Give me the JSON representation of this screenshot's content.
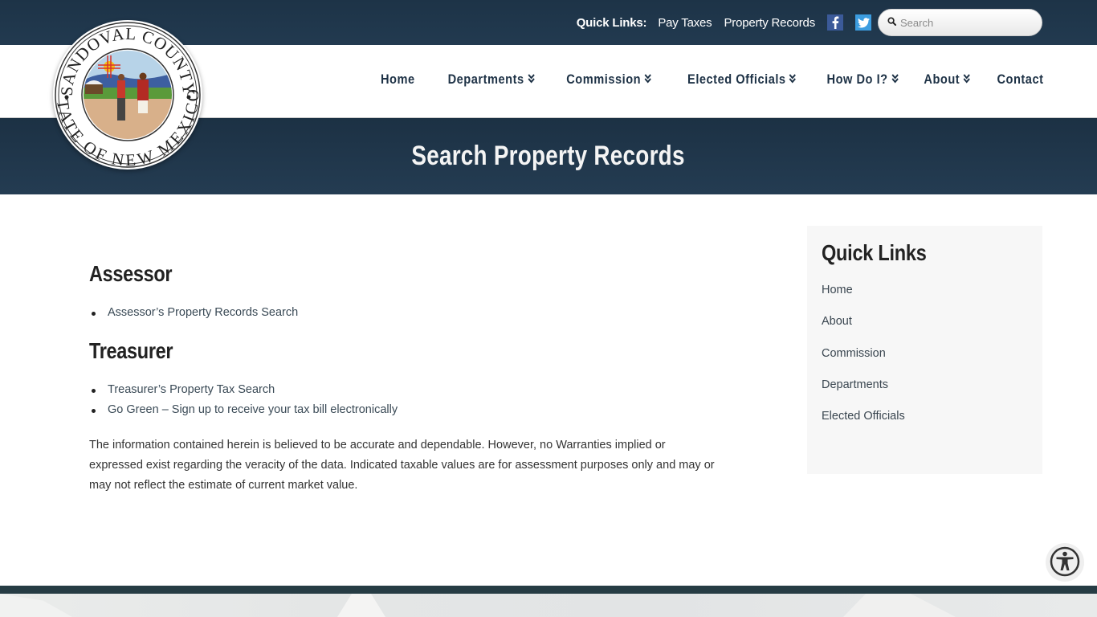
{
  "topbar": {
    "quick_links_label": "Quick Links:",
    "links": [
      "Pay Taxes",
      "Property Records"
    ],
    "social": [
      {
        "name": "facebook",
        "icon": "facebook-icon",
        "color": "#3b5a99"
      },
      {
        "name": "twitter",
        "icon": "twitter-icon",
        "color": "#3c9de0"
      }
    ],
    "search": {
      "placeholder": "Search",
      "value": "",
      "icon": "search-icon"
    }
  },
  "logo": {
    "alt": "Sandoval County State of New Mexico seal",
    "top_text": "SANDOVAL COUNTY",
    "bottom_text": "STATE OF NEW MEXICO"
  },
  "nav": {
    "items": [
      {
        "label": "Home",
        "dropdown": false
      },
      {
        "label": "Departments",
        "dropdown": true
      },
      {
        "label": "Commission",
        "dropdown": true
      },
      {
        "label": "Elected Officials",
        "dropdown": true
      },
      {
        "label": "How Do I?",
        "dropdown": true
      },
      {
        "label": "About",
        "dropdown": true
      },
      {
        "label": "Contact",
        "dropdown": false
      }
    ]
  },
  "banner": {
    "title": "Search Property Records"
  },
  "main": {
    "sections": [
      {
        "heading": "Assessor",
        "links": [
          "Assessor’s Property Records Search"
        ]
      },
      {
        "heading": "Treasurer",
        "links": [
          "Treasurer’s Property Tax Search",
          "Go Green – Sign up to receive your tax bill electronically"
        ]
      }
    ],
    "disclaimer": "The information contained herein is believed to be accurate and dependable. However, no Warranties implied or expressed exist regarding the veracity of the data. Indicated taxable values are for assessment purposes only and may or may not reflect the estimate of current market value."
  },
  "sidebar": {
    "title": "Quick Links",
    "links": [
      "Home",
      "About",
      "Commission",
      "Departments",
      "Elected Officials"
    ]
  },
  "accessibility": {
    "icon": "accessibility-icon",
    "label": "Accessibility options"
  },
  "colors": {
    "navy": "#1e3246",
    "banner": "#223a50",
    "footer_bar": "#263c44",
    "sidebar_bg": "#f7f7f7"
  }
}
